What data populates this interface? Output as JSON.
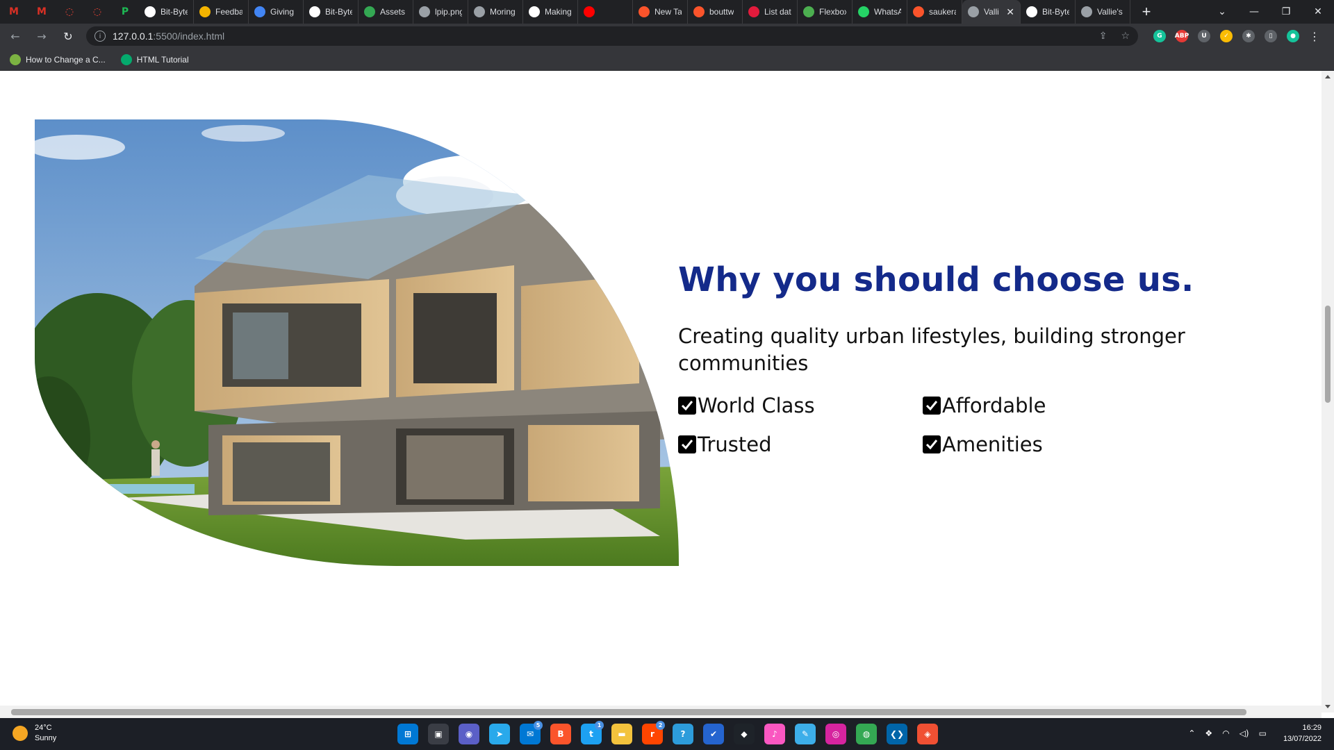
{
  "browser": {
    "pinned_tabs": [
      {
        "icon": "gmail-icon",
        "glyph": "M",
        "color": "#d93025"
      },
      {
        "icon": "gmail-icon",
        "glyph": "M",
        "color": "#d93025"
      },
      {
        "icon": "circle-red-icon",
        "glyph": "◌",
        "color": "#ea4335"
      },
      {
        "icon": "circle-red-icon",
        "glyph": "◌",
        "color": "#ea4335"
      },
      {
        "icon": "green-app-icon",
        "glyph": "P",
        "color": "#1db954"
      }
    ],
    "tabs": [
      {
        "label": "Bit-Byte",
        "icon": "github-icon",
        "color": "#ffffff"
      },
      {
        "label": "Feedba",
        "icon": "slides-icon",
        "color": "#f4b400"
      },
      {
        "label": "Giving",
        "icon": "docs-icon",
        "color": "#4285f4"
      },
      {
        "label": "Bit-Byte",
        "icon": "github-icon",
        "color": "#ffffff"
      },
      {
        "label": "Assets",
        "icon": "drive-icon",
        "color": "#34a853"
      },
      {
        "label": "lpip.png",
        "icon": "globe-icon",
        "color": "#9aa0a6"
      },
      {
        "label": "Moring",
        "icon": "bolt-icon",
        "color": "#9aa0a6"
      },
      {
        "label": "Making",
        "icon": "medium-icon",
        "color": "#ffffff"
      },
      {
        "label": "",
        "icon": "youtube-icon",
        "color": "#ff0000"
      },
      {
        "label": "New Ta",
        "icon": "brave-icon",
        "color": "#fb542b"
      },
      {
        "label": "bouttw",
        "icon": "brave-icon",
        "color": "#fb542b"
      },
      {
        "label": "List dat",
        "icon": "lb-icon",
        "color": "#e21b3c"
      },
      {
        "label": "Flexbox",
        "icon": "frog-icon",
        "color": "#4caf50"
      },
      {
        "label": "WhatsA",
        "icon": "whatsapp-icon",
        "color": "#25d366"
      },
      {
        "label": "saukera",
        "icon": "brave-icon",
        "color": "#fb542b"
      },
      {
        "label": "Valli",
        "icon": "globe-icon",
        "color": "#9aa0a6",
        "active": true
      },
      {
        "label": "Bit-Byte",
        "icon": "github-icon",
        "color": "#ffffff"
      },
      {
        "label": "Vallie's",
        "icon": "globe-icon",
        "color": "#9aa0a6"
      }
    ],
    "url_host": "127.0.0.1",
    "url_path": ":5500/index.html",
    "bookmarks": [
      {
        "label": "How to Change a C...",
        "color": "#7cb342"
      },
      {
        "label": "HTML Tutorial",
        "color": "#04aa6d"
      }
    ],
    "extensions": [
      {
        "name": "grammarly-icon",
        "glyph": "G",
        "color": "#15c39a"
      },
      {
        "name": "adblock-icon",
        "glyph": "ABP",
        "color": "#e53935"
      },
      {
        "name": "shield-icon",
        "glyph": "U",
        "color": "#5f6368"
      },
      {
        "name": "color-picker-icon",
        "glyph": "✓",
        "color": "#fbbc04"
      },
      {
        "name": "puzzle-icon",
        "glyph": "✱",
        "color": "#5f6368"
      },
      {
        "name": "sidepanel-icon",
        "glyph": "▯",
        "color": "#5f6368"
      },
      {
        "name": "profile-icon",
        "glyph": "●",
        "color": "#15c39a"
      }
    ]
  },
  "page": {
    "title": "Why you should choose us.",
    "subtitle": "Creating quality urban lifestyles, building stronger communities",
    "features": [
      "World Class",
      "Affordable",
      "Trusted",
      "Amenities"
    ],
    "colors": {
      "title": "#142a8a",
      "text": "#111111"
    }
  },
  "taskbar": {
    "weather_temp": "24°C",
    "weather_desc": "Sunny",
    "time": "16:29",
    "date": "13/07/2022",
    "apps": [
      {
        "name": "windows-start-icon",
        "glyph": "⊞",
        "color": "#0078d4"
      },
      {
        "name": "task-view-icon",
        "glyph": "▣",
        "color": "#3a3d45"
      },
      {
        "name": "teams-chat-icon",
        "glyph": "◉",
        "color": "#5b5fc7"
      },
      {
        "name": "telegram-icon",
        "glyph": "➤",
        "color": "#29a9eb"
      },
      {
        "name": "mail-icon",
        "glyph": "✉",
        "color": "#0078d4",
        "badge": "5"
      },
      {
        "name": "brave-icon",
        "glyph": "B",
        "color": "#fb542b"
      },
      {
        "name": "twitter-icon",
        "glyph": "t",
        "color": "#1da1f2",
        "badge": "1"
      },
      {
        "name": "file-explorer-icon",
        "glyph": "▬",
        "color": "#f3c33d"
      },
      {
        "name": "reddit-icon",
        "glyph": "r",
        "color": "#ff4500",
        "badge": "2"
      },
      {
        "name": "help-icon",
        "glyph": "?",
        "color": "#2d9cdb"
      },
      {
        "name": "todo-icon",
        "glyph": "✔",
        "color": "#2564cf"
      },
      {
        "name": "binance-icon",
        "glyph": "◆",
        "color": "#1e2329"
      },
      {
        "name": "itunes-icon",
        "glyph": "♪",
        "color": "#fa57c1"
      },
      {
        "name": "krita-icon",
        "glyph": "✎",
        "color": "#3daee9"
      },
      {
        "name": "instagram-icon",
        "glyph": "◎",
        "color": "#d6249f"
      },
      {
        "name": "chrome-icon",
        "glyph": "◍",
        "color": "#34a853"
      },
      {
        "name": "vscode-icon",
        "glyph": "❮❯",
        "color": "#0065a9"
      },
      {
        "name": "git-icon",
        "glyph": "◈",
        "color": "#f05033"
      }
    ]
  }
}
